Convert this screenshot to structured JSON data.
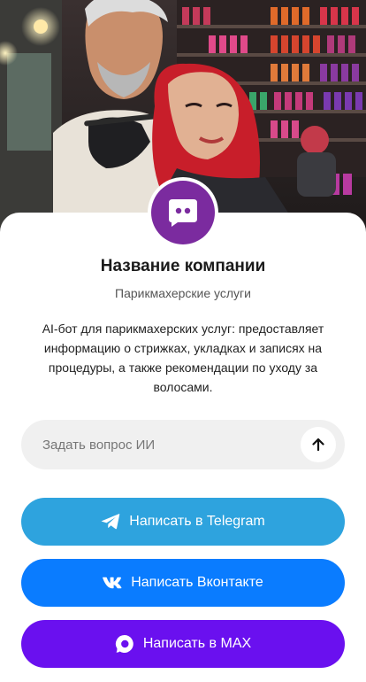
{
  "hero": {
    "image_name": "hair-salon-photo"
  },
  "company": {
    "name": "Название компании",
    "type": "Парикмахерские услуги",
    "description": "AI-бот для парикмахерских услуг: предоставляет информацию о стрижках, укладках и записях на процедуры, а также рекомендации по уходу за волосами.",
    "avatar_icon": "chat-bot-icon",
    "avatar_color": "#7b2b9f"
  },
  "ask": {
    "placeholder": "Задать вопрос ИИ",
    "send_icon": "arrow-up-icon"
  },
  "buttons": {
    "telegram": {
      "label": "Написать в Telegram",
      "icon": "telegram-icon",
      "color": "#2ea3de"
    },
    "vk": {
      "label": "Написать Вконтакте",
      "icon": "vk-icon",
      "color": "#0a7cff"
    },
    "max": {
      "label": "Написать в MAX",
      "icon": "max-icon",
      "color": "#6a10ef"
    }
  }
}
